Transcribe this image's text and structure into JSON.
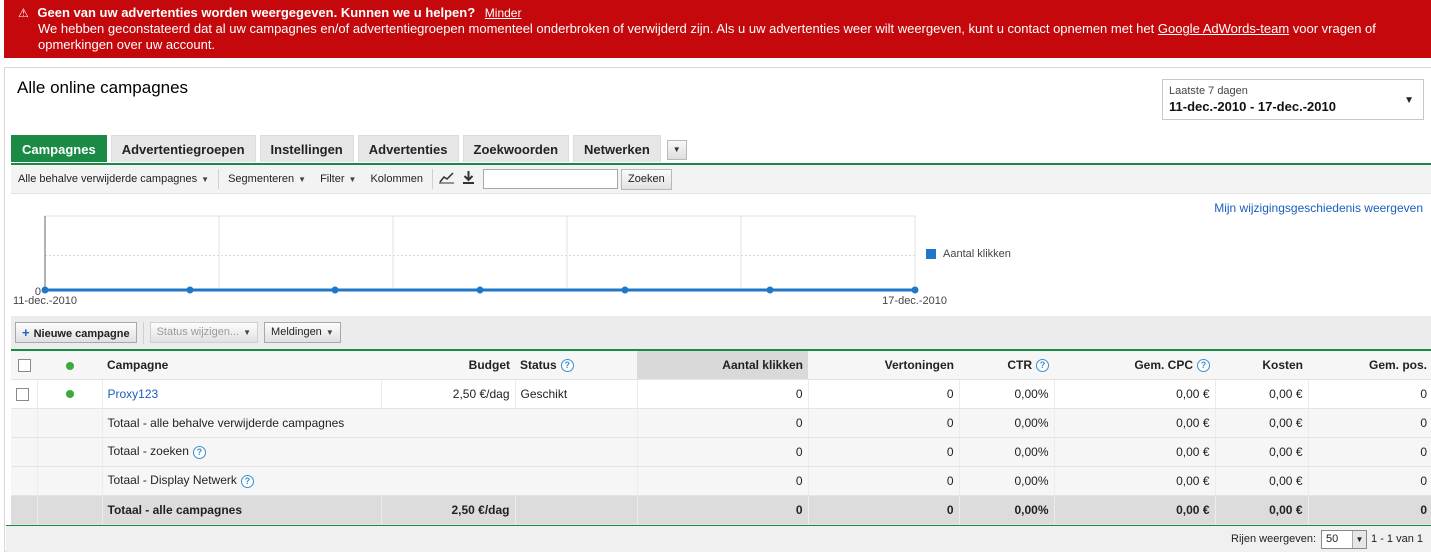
{
  "alert": {
    "title": "Geen van uw advertenties worden weergegeven. Kunnen we u helpen?",
    "less_link": "Minder",
    "body_before": "We hebben geconstateerd dat al uw campagnes en/of advertentiegroepen momenteel onderbroken of verwijderd zijn. Als u uw advertenties weer wilt weergeven, kunt u contact opnemen met het ",
    "body_link": "Google AdWords-team",
    "body_after": " voor vragen of opmerkingen over uw account."
  },
  "header": {
    "title": "Alle online campagnes",
    "date_label": "Laatste 7 dagen",
    "date_range": "11-dec.-2010 - 17-dec.-2010"
  },
  "tabs": [
    "Campagnes",
    "Advertentiegroepen",
    "Instellingen",
    "Advertenties",
    "Zoekwoorden",
    "Netwerken"
  ],
  "toolbar": {
    "filter_view": "Alle behalve verwijderde campagnes",
    "segment": "Segmenteren",
    "filter": "Filter",
    "columns": "Kolommen",
    "search_value": "",
    "search_button": "Zoeken"
  },
  "history_link": "Mijn wijzigingsgeschiedenis weergeven",
  "chart_data": {
    "type": "line",
    "x_start_label": "11-dec.-2010",
    "x_end_label": "17-dec.-2010",
    "y_tick": "0",
    "series": [
      {
        "name": "Aantal klikken",
        "values": [
          0,
          0,
          0,
          0,
          0,
          0,
          0
        ]
      }
    ],
    "color": "#1f77c9"
  },
  "actions": {
    "new_campaign": "Nieuwe campagne",
    "change_status": "Status wijzigen...",
    "notifications": "Meldingen"
  },
  "table": {
    "headers": {
      "campaign": "Campagne",
      "budget": "Budget",
      "status": "Status",
      "clicks": "Aantal klikken",
      "impressions": "Vertoningen",
      "ctr": "CTR",
      "avg_cpc": "Gem. CPC",
      "cost": "Kosten",
      "avg_pos": "Gem. pos."
    },
    "campaign_row": {
      "name": "Proxy123",
      "budget": "2,50 €/dag",
      "status": "Geschikt",
      "clicks": "0",
      "impressions": "0",
      "ctr": "0,00%",
      "avg_cpc": "0,00 €",
      "cost": "0,00 €",
      "avg_pos": "0"
    },
    "totals": [
      {
        "label": "Totaal - alle behalve verwijderde campagnes",
        "clicks": "0",
        "impressions": "0",
        "ctr": "0,00%",
        "avg_cpc": "0,00 €",
        "cost": "0,00 €",
        "avg_pos": "0"
      },
      {
        "label": "Totaal - zoeken",
        "clicks": "0",
        "impressions": "0",
        "ctr": "0,00%",
        "avg_cpc": "0,00 €",
        "cost": "0,00 €",
        "avg_pos": "0"
      },
      {
        "label": "Totaal - Display Netwerk",
        "clicks": "0",
        "impressions": "0",
        "ctr": "0,00%",
        "avg_cpc": "0,00 €",
        "cost": "0,00 €",
        "avg_pos": "0"
      }
    ],
    "grand_total": {
      "label": "Totaal - alle campagnes",
      "budget": "2,50 €/dag",
      "clicks": "0",
      "impressions": "0",
      "ctr": "0,00%",
      "avg_cpc": "0,00 €",
      "cost": "0,00 €",
      "avg_pos": "0"
    }
  },
  "footer": {
    "rows_label": "Rijen weergeven:",
    "rows_value": "50",
    "range": "1 - 1 van 1"
  }
}
